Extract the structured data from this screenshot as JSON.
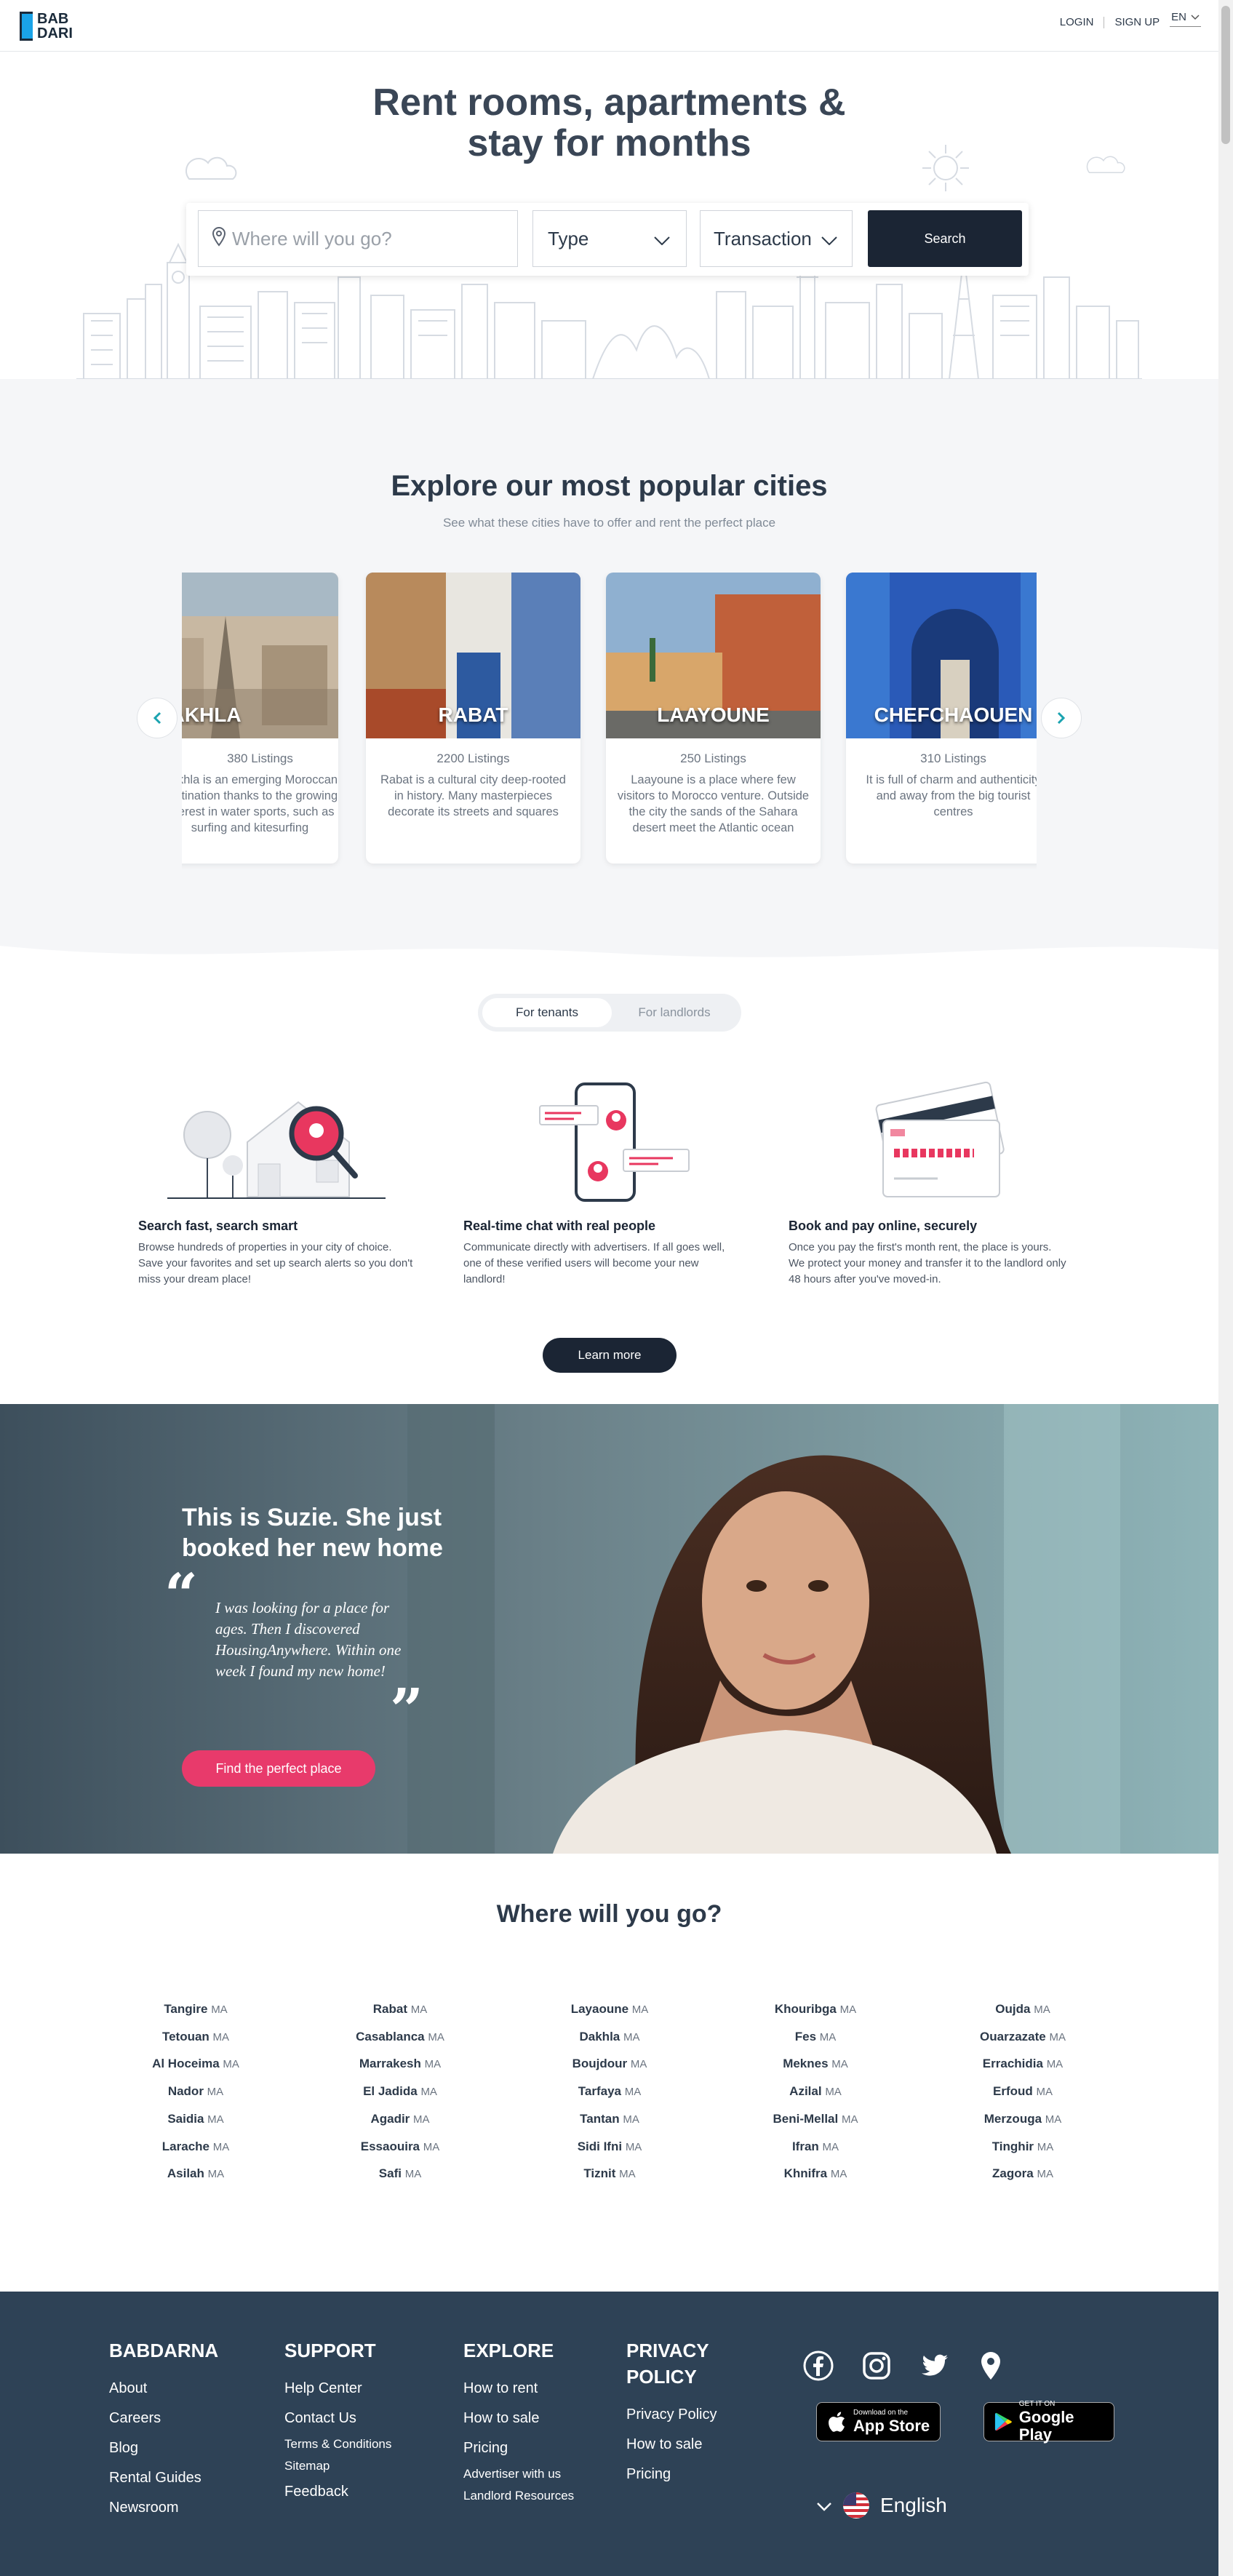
{
  "header": {
    "logo_line1": "BAB",
    "logo_line2": "DARI",
    "login": "LOGIN",
    "signup": "SIGN UP",
    "language": "EN"
  },
  "hero": {
    "title_line1": "Rent rooms, apartments &",
    "title_line2": "stay for months",
    "where_placeholder": "Where will you go?",
    "type_label": "Type",
    "transaction_label": "Transaction",
    "search_label": "Search"
  },
  "cities": {
    "title": "Explore our most popular cities",
    "subtitle": "See what these cities have to offer and rent the perfect place",
    "cards": [
      {
        "name": "DAKHLA",
        "count": "380 Listings",
        "desc": "Dakhla is an emerging Moroccan destination thanks to the growing interest in water sports, such as surfing and kitesurfing"
      },
      {
        "name": "RABAT",
        "count": "2200 Listings",
        "desc": "Rabat is a cultural city deep-rooted in history. Many masterpieces decorate its streets and squares"
      },
      {
        "name": "LAAYOUNE",
        "count": "250 Listings",
        "desc": "Laayoune is a place where few visitors to Morocco venture. Outside the city the sands of the Sahara desert meet the Atlantic ocean"
      },
      {
        "name": "CHEFCHAOUEN",
        "count": "310 Listings",
        "desc": "It is full of charm and authenticity and away from the big tourist centres"
      }
    ]
  },
  "tenants": {
    "tab_tenants": "For tenants",
    "tab_landlords": "For landlords",
    "features": [
      {
        "title": "Search fast, search smart",
        "text": "Browse hundreds of properties in your city of choice. Save your favorites and set up search alerts so you don't miss your dream place!"
      },
      {
        "title": "Real-time chat with real people",
        "text": "Communicate directly with advertisers. If all goes well, one of these verified users will become your new landlord!"
      },
      {
        "title": "Book and pay online, securely",
        "text": "Once you pay the first's month rent, the place is yours. We protect your money and transfer it to the landlord only 48 hours after you've moved-in."
      }
    ],
    "learn_more": "Learn more"
  },
  "testimonial": {
    "title": "This is Suzie. She just booked her new home",
    "quote": "I was looking for a place for ages. Then I discovered HousingAnywhere. Within one week I found my new home!",
    "cta": "Find the perfect place"
  },
  "where": {
    "title": "Where will you go?",
    "suffix": "MA",
    "columns": [
      [
        "Tangire",
        "Tetouan",
        "Al Hoceima",
        "Nador",
        "Saidia",
        "Larache",
        "Asilah"
      ],
      [
        "Rabat",
        "Casablanca",
        "Marrakesh",
        "El Jadida",
        "Agadir",
        "Essaouira",
        "Safi"
      ],
      [
        "Layaoune",
        "Dakhla",
        "Boujdour",
        "Tarfaya",
        "Tantan",
        "Sidi Ifni",
        "Tiznit"
      ],
      [
        "Khouribga",
        "Fes",
        "Meknes",
        "Azilal",
        "Beni-Mellal",
        "Ifran",
        "Khnifra"
      ],
      [
        "Oujda",
        "Ouarzazate",
        "Errachidia",
        "Erfoud",
        "Merzouga",
        "Tinghir",
        "Zagora"
      ]
    ]
  },
  "footer": {
    "col1": {
      "title": "BABDARNA",
      "links": [
        "About",
        "Careers",
        "Blog",
        "Rental Guides",
        "Newsroom"
      ]
    },
    "col2": {
      "title": "SUPPORT",
      "links": [
        "Help Center",
        "Contact Us",
        "Terms & Conditions",
        "Sitemap",
        "Feedback"
      ]
    },
    "col3": {
      "title": "EXPLORE",
      "links": [
        "How to rent",
        "How to sale",
        "Pricing",
        "Advertiser with us",
        "Landlord Resources"
      ]
    },
    "col4": {
      "title_line1": "PRIVACY",
      "title_line2": "POLICY",
      "links": [
        "Privacy Policy",
        "How to sale",
        "Pricing"
      ]
    },
    "appstore_small": "Download on the",
    "appstore_big": "App Store",
    "googleplay_small": "GET IT ON",
    "googleplay_big": "Google Play",
    "language": "English",
    "icons": [
      "facebook-icon",
      "instagram-icon",
      "twitter-icon",
      "location-pin-icon"
    ]
  }
}
